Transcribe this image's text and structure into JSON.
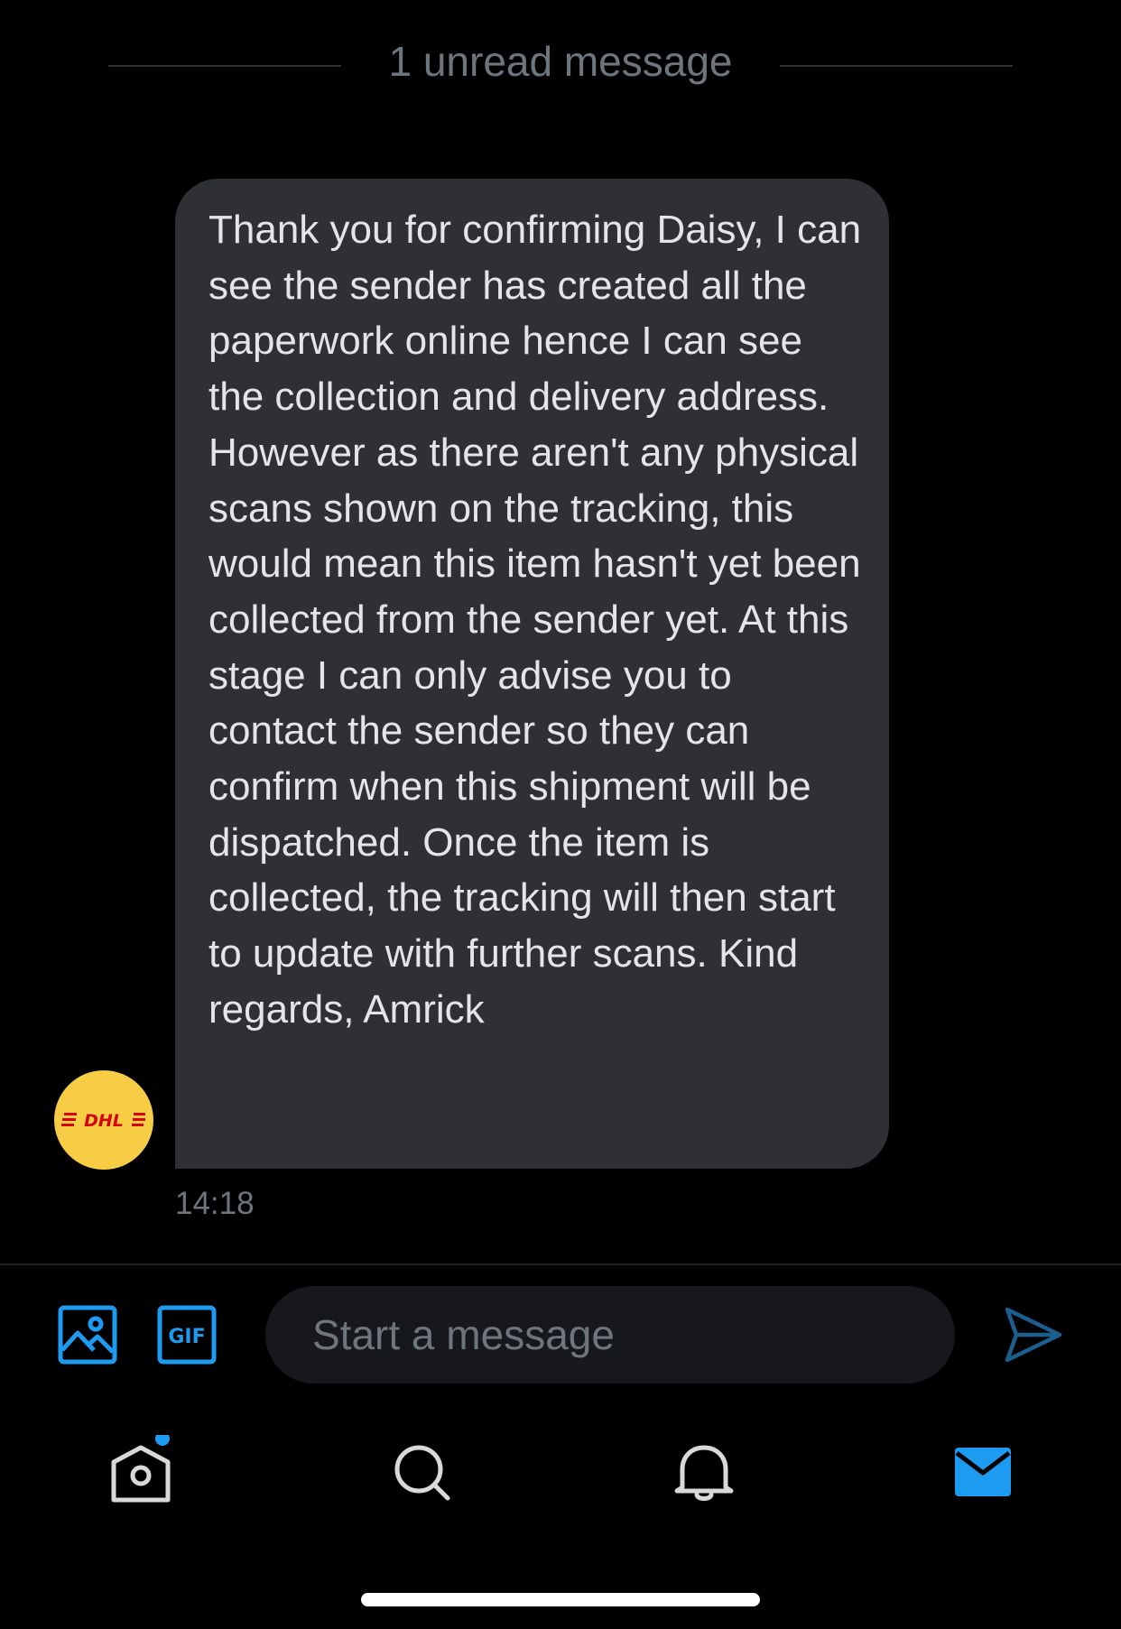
{
  "conversation": {
    "unread_divider": "1 unread message",
    "message": {
      "text": "Thank you for confirming Daisy, I can see the sender has created all the paperwork online hence I can see the collection and delivery address. However as there aren't any physical scans shown on the tracking, this would mean this item hasn't yet been collected from the sender yet. At this stage I can only advise you to contact the sender so they can confirm when this shipment will be dispatched. Once the item is collected, the tracking will then start to update with further scans. Kind regards, Amrick",
      "time": "14:18",
      "sender_avatar": {
        "brand_text": "DHL",
        "background_color": "#f7cd46",
        "logo_color": "#d40511"
      }
    }
  },
  "composer": {
    "placeholder": "Start a message",
    "image_icon": "image-icon",
    "gif_label": "GIF",
    "send_icon": "send-icon",
    "accent_color": "#1d9bf0"
  },
  "tab_bar": {
    "tabs": [
      {
        "icon": "home-icon",
        "notification_dot": true
      },
      {
        "icon": "search-icon"
      },
      {
        "icon": "bell-icon"
      },
      {
        "icon": "mail-icon",
        "active": true
      }
    ]
  },
  "colors": {
    "background": "#000000",
    "bubble": "#2e3033",
    "secondary_text": "#6e767d",
    "accent": "#1d9bf0"
  }
}
